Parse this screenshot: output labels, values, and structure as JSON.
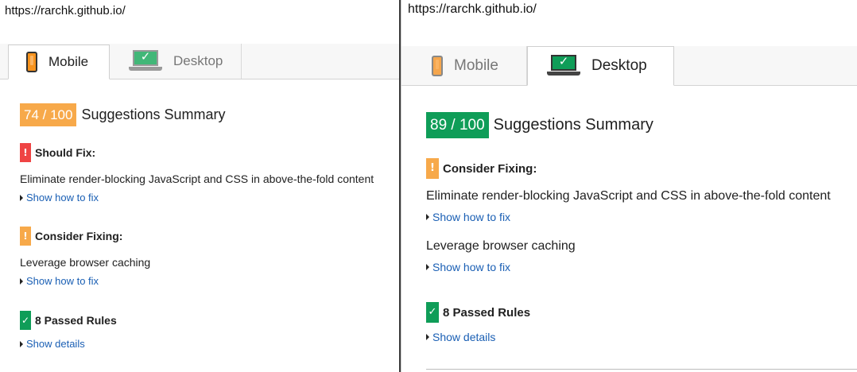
{
  "left": {
    "url": "https://rarchk.github.io/",
    "tabs": [
      {
        "label": "Mobile",
        "icon": "phone-icon",
        "active": true
      },
      {
        "label": "Desktop",
        "icon": "laptop-icon",
        "active": false
      }
    ],
    "score": "74 / 100",
    "score_color": "#f7a94a",
    "summary_title": "Suggestions Summary",
    "should_fix": {
      "icon_text": "!",
      "title": "Should Fix:",
      "rules": [
        "Eliminate render-blocking JavaScript and CSS in above-the-fold content"
      ],
      "link": "Show how to fix"
    },
    "consider_fixing": {
      "icon_text": "!",
      "title": "Consider Fixing:",
      "rules": [
        "Leverage browser caching"
      ],
      "link": "Show how to fix"
    },
    "passed": {
      "icon_text": "✓",
      "title": "8 Passed Rules",
      "link": "Show details"
    }
  },
  "right": {
    "url": "https://rarchk.github.io/",
    "tabs": [
      {
        "label": "Mobile",
        "icon": "phone-icon",
        "active": false
      },
      {
        "label": "Desktop",
        "icon": "laptop-icon",
        "active": true
      }
    ],
    "score": "89 / 100",
    "score_color": "#0f9d58",
    "summary_title": "Suggestions Summary",
    "consider_fixing": {
      "icon_text": "!",
      "title": "Consider Fixing:",
      "rules": [
        "Eliminate render-blocking JavaScript and CSS in above-the-fold content",
        "Leverage browser caching"
      ],
      "links": [
        "Show how to fix",
        "Show how to fix"
      ]
    },
    "passed": {
      "icon_text": "✓",
      "title": "8 Passed Rules",
      "link": "Show details"
    }
  }
}
